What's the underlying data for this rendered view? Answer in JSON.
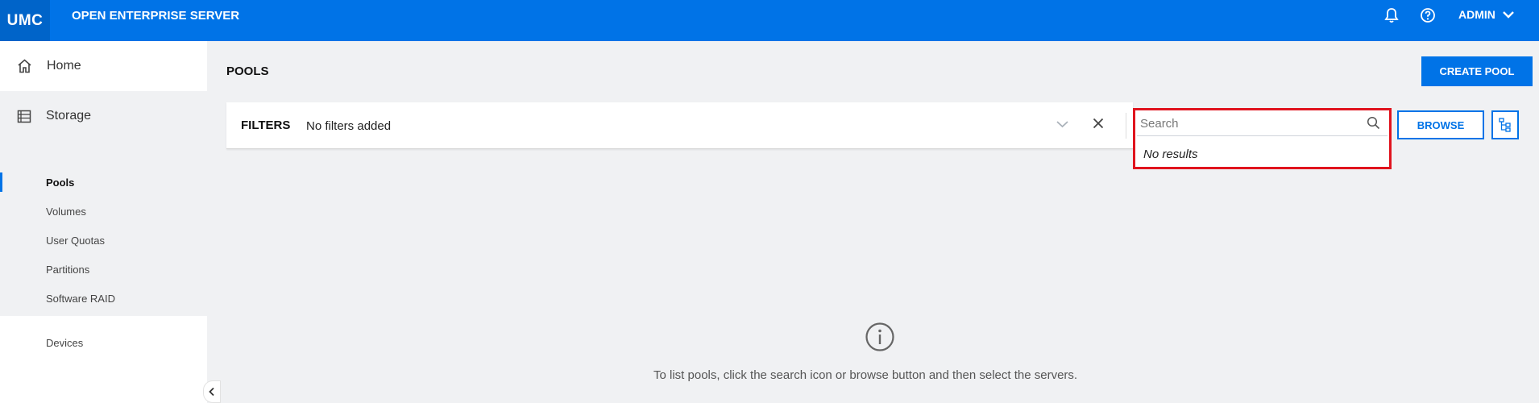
{
  "topbar": {
    "logo": "UMC",
    "title": "OPEN ENTERPRISE SERVER",
    "user": "ADMIN",
    "icons": [
      "bell-icon",
      "help-icon",
      "chevron-down-icon"
    ]
  },
  "sidebar": {
    "home": "Home",
    "storage": "Storage",
    "items": [
      {
        "label": "Pools",
        "active": true
      },
      {
        "label": "Volumes"
      },
      {
        "label": "User Quotas"
      },
      {
        "label": "Partitions"
      },
      {
        "label": "Software RAID"
      },
      {
        "label": "Devices"
      }
    ]
  },
  "main": {
    "title": "POOLS",
    "create_button": "CREATE POOL",
    "filters": {
      "label": "FILTERS",
      "value": "No filters added"
    },
    "search": {
      "placeholder": "Search",
      "no_results": "No results"
    },
    "browse_button": "BROWSE",
    "empty_message": "To list pools, click the search icon or browse button and then select the servers."
  },
  "colors": {
    "accent": "#0073e7",
    "logo_bg": "#0064c9",
    "highlight": "#e0141e",
    "background": "#f0f1f3"
  }
}
